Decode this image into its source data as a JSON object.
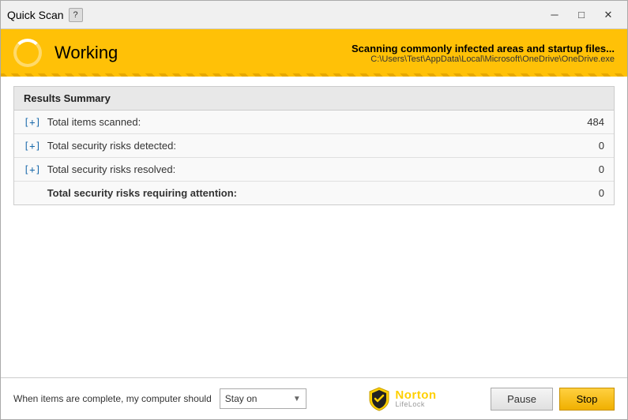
{
  "window": {
    "title": "Quick Scan",
    "help_label": "?",
    "minimize_icon": "─",
    "maximize_icon": "□",
    "close_icon": "✕"
  },
  "status": {
    "state": "Working",
    "scanning_label": "Scanning commonly infected areas and startup files...",
    "scanning_path": "C:\\Users\\Test\\AppData\\Local\\Microsoft\\OneDrive\\OneDrive.exe"
  },
  "results": {
    "header": "Results Summary",
    "rows": [
      {
        "expandable": true,
        "label": "Total items scanned:",
        "value": "484"
      },
      {
        "expandable": true,
        "label": "Total security risks detected:",
        "value": "0"
      },
      {
        "expandable": true,
        "label": "Total security risks resolved:",
        "value": "0"
      },
      {
        "expandable": false,
        "label": "Total security risks requiring attention:",
        "value": "0"
      }
    ]
  },
  "bottom": {
    "complete_label": "When items are complete, my computer should",
    "dropdown_value": "Stay on",
    "dropdown_arrow": "▼"
  },
  "norton": {
    "name": "Norton",
    "sub": "LifeLock"
  },
  "buttons": {
    "pause_label": "Pause",
    "stop_label": "Stop"
  }
}
